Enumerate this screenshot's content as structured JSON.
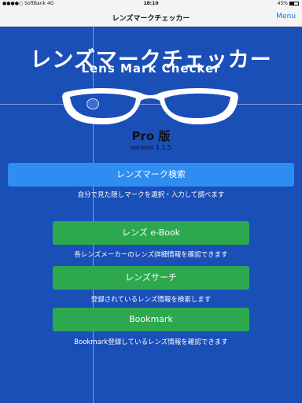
{
  "status_bar": {
    "carrier": "●●●●○ SoftBank  4G",
    "time": "18:10",
    "battery": "45%"
  },
  "nav": {
    "title": "レンズマークチェッカー",
    "menu": "Menu"
  },
  "hero": {
    "title_jp": "レンズマークチェッカー",
    "title_en": "Lens Mark Checker",
    "edition": "Pro 版",
    "version": "version 1.1.5",
    "glasses_icon": "eyeglasses-icon"
  },
  "actions": {
    "mark_search": {
      "label": "レンズマーク検索",
      "description": "自分で見た隠しマークを選択・入力して調べます"
    },
    "ebook": {
      "label": "レンズ e-Book",
      "description": "各レンズメーカーのレンズ詳細情報を確認できます"
    },
    "lens_search": {
      "label": "レンズサーチ",
      "description": "登録されているレンズ情報を検索します"
    },
    "bookmark": {
      "label": "Bookmark",
      "description": "Bookmark登録しているレンズ情報を確認できます"
    }
  },
  "colors": {
    "background": "#1a4fb8",
    "primary_button": "#2f8cf0",
    "secondary_button": "#2ea84f",
    "link": "#1a73e8"
  }
}
